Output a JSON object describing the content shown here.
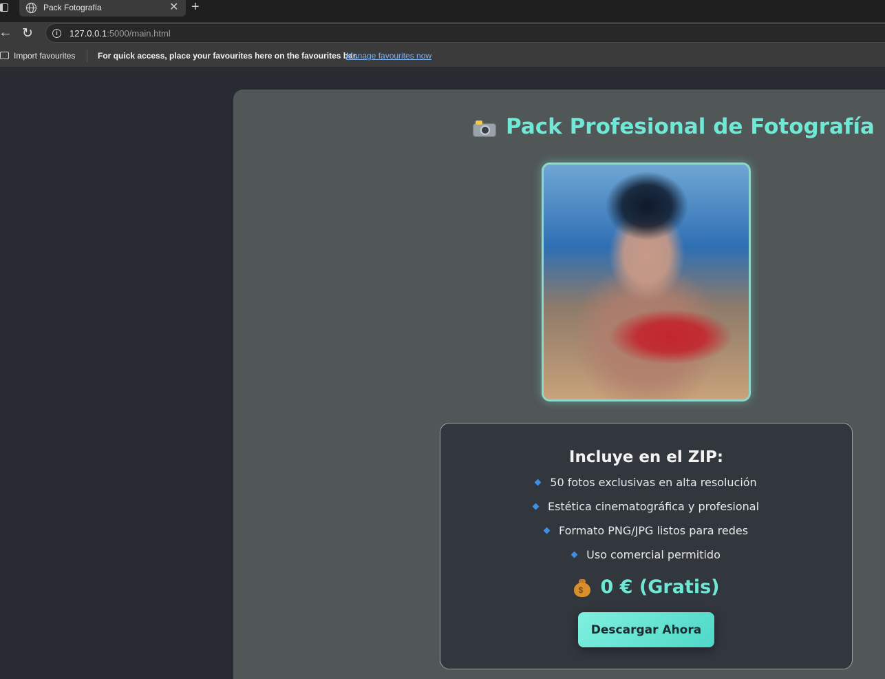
{
  "browser": {
    "tab_title": "Pack Fotografía",
    "tab_close": "✕",
    "new_tab": "+",
    "url_host": "127.0.0.1",
    "url_rest": ":5000/main.html",
    "import_favourites": "Import favourites",
    "favourites_message": "For quick access, place your favourites here on the favourites bar.",
    "manage_favourites": "Manage favourites now"
  },
  "page": {
    "title": "Pack Profesional de Fotografía",
    "box_title": "Incluye en el ZIP:",
    "features": [
      "50 fotos exclusivas en alta resolución",
      "Estética cinematográfica y profesional",
      "Formato PNG/JPG listos para redes",
      "Uso comercial permitido"
    ],
    "price": "0 € (Gratis)",
    "button_label": "Descargar Ahora"
  },
  "colors": {
    "accent": "#6fe9d6",
    "bullet": "#3d8fe6",
    "card_bg": "#515657",
    "box_bg": "#32363d",
    "page_bg": "#282b32"
  },
  "icons": {
    "title_icon": "camera-with-flash-icon",
    "price_icon": "money-bag-icon"
  }
}
